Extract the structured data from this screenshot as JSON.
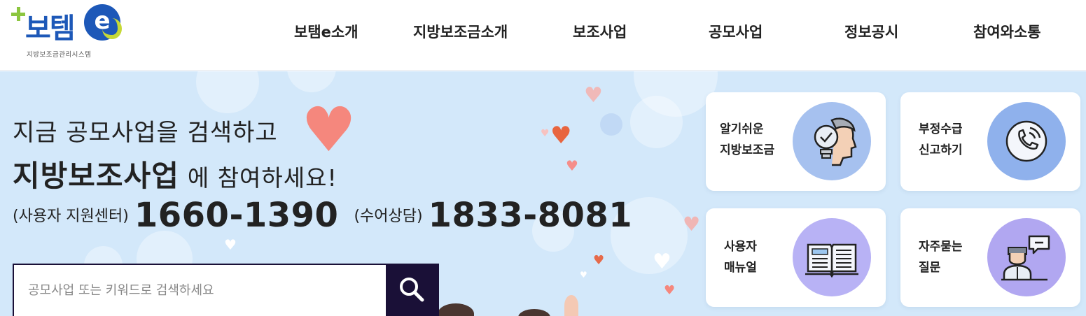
{
  "logo": {
    "main": "보템",
    "badge": "e",
    "subtitle": "지방보조금관리시스템"
  },
  "nav": {
    "items": [
      {
        "label": "보탬e소개"
      },
      {
        "label": "지방보조금소개"
      },
      {
        "label": "보조사업"
      },
      {
        "label": "공모사업"
      },
      {
        "label": "정보공시"
      },
      {
        "label": "참여와소통"
      }
    ]
  },
  "hero": {
    "line1": "지금 공모사업을 검색하고",
    "line2_strong": "지방보조사업",
    "line2_rest": "에 참여하세요!",
    "support_label": "(사용자 지원센터)",
    "support_number": "1660-1390",
    "sign_label": "(수어상담)",
    "sign_number": "1833-8081"
  },
  "search": {
    "placeholder": "공모사업 또는 키워드로 검색하세요",
    "value": ""
  },
  "quick_links": [
    {
      "label": "알기쉬운\n지방보조금",
      "icon": "lightbulb-head-icon",
      "color": "#a6c1ef"
    },
    {
      "label": "부정수급\n신고하기",
      "icon": "phone-icon",
      "color": "#8fb1ec"
    },
    {
      "label": "사용자\n매뉴얼",
      "icon": "book-icon",
      "color": "#b8b2f5"
    },
    {
      "label": "자주묻는\n질문",
      "icon": "person-speech-icon",
      "color": "#b1a7f1"
    }
  ],
  "colors": {
    "brand_blue": "#1d58b8",
    "brand_green": "#8cc63f",
    "hero_bg": "#d3e8fa",
    "search_dark": "#1a1037"
  }
}
